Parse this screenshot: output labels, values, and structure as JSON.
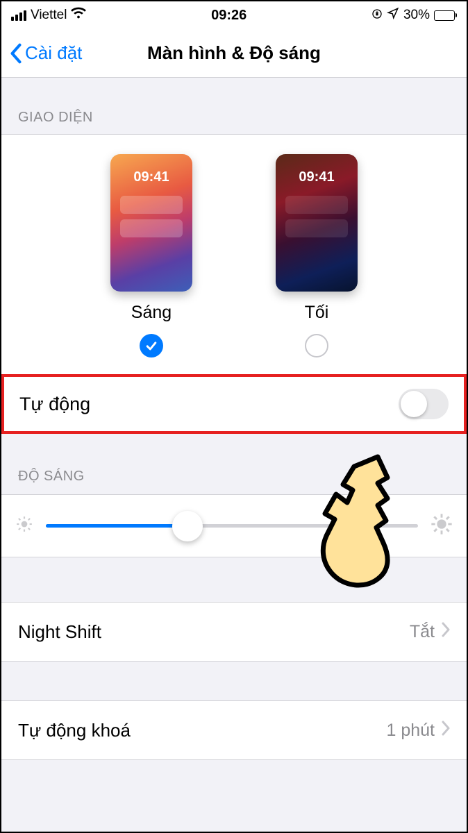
{
  "status": {
    "carrier": "Viettel",
    "time": "09:26",
    "battery_text": "30%",
    "battery_fill_percent": 30
  },
  "nav": {
    "back_label": "Cài đặt",
    "title": "Màn hình & Độ sáng"
  },
  "appearance": {
    "section_header": "GIAO DIỆN",
    "preview_time": "09:41",
    "modes": {
      "light_label": "Sáng",
      "dark_label": "Tối"
    },
    "selected": "light"
  },
  "auto": {
    "label": "Tự động",
    "enabled": false
  },
  "brightness": {
    "header": "ĐỘ SÁNG",
    "slider_percent": 38
  },
  "rows": {
    "night_shift_label": "Night Shift",
    "night_shift_value": "Tắt",
    "auto_lock_label": "Tự động khoá",
    "auto_lock_value": "1 phút"
  }
}
